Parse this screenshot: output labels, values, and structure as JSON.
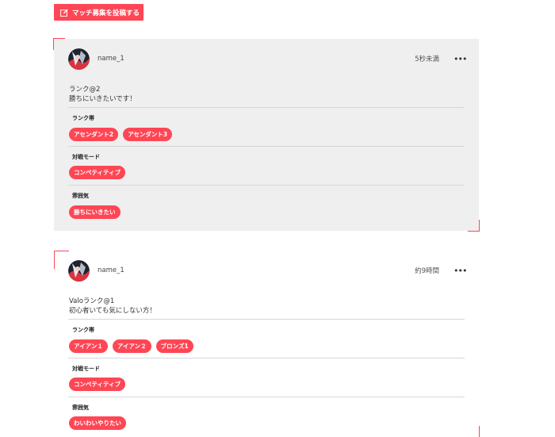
{
  "header": {
    "post_button_label": "マッチ募集を投稿する"
  },
  "posts": [
    {
      "username": "name_1",
      "time": "5秒未満",
      "lines": [
        "ランク@2",
        "勝ちにいきたいです！"
      ],
      "sections": [
        {
          "label": "ランク帯",
          "tags": [
            "アセンダント2",
            "アセンダント3"
          ]
        },
        {
          "label": "対戦モード",
          "tags": [
            "コンペティティブ"
          ]
        },
        {
          "label": "雰囲気",
          "tags": [
            "勝ちにいきたい"
          ]
        }
      ]
    },
    {
      "username": "name_1",
      "time": "約9時間",
      "lines": [
        "Valoランク@1",
        "初心者いても気にしない方！"
      ],
      "sections": [
        {
          "label": "ランク帯",
          "tags": [
            "アイアン１",
            "アイアン２",
            "ブロンズ1"
          ]
        },
        {
          "label": "対戦モード",
          "tags": [
            "コンペティティブ"
          ]
        },
        {
          "label": "雰囲気",
          "tags": [
            "わいわいやりたい"
          ]
        }
      ]
    }
  ],
  "colors": {
    "accent": "#ff4655",
    "card_bg": "#efefef"
  },
  "icons": {
    "post_button": "pencil-square-icon",
    "more": "more-horizontal-icon",
    "avatar": "user-avatar"
  }
}
